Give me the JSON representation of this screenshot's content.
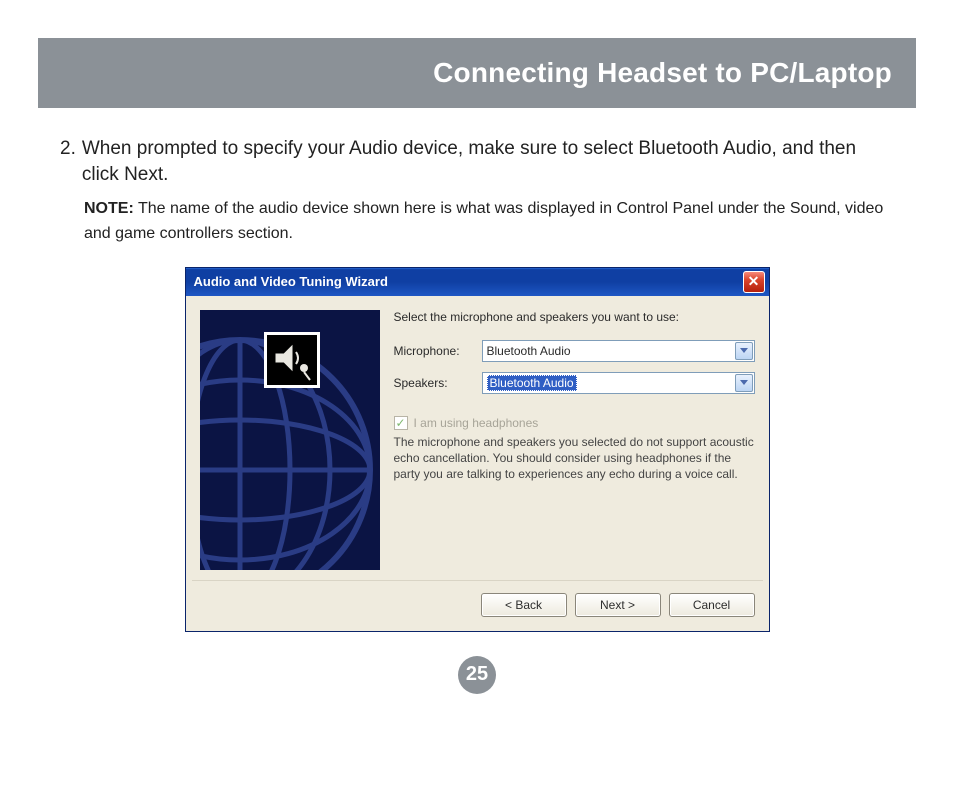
{
  "header": {
    "title": "Connecting Headset to PC/Laptop"
  },
  "step": {
    "number": "2.",
    "text": "When prompted to specify your Audio device, make sure to select Bluetooth Audio, and then click Next."
  },
  "note": {
    "label": "NOTE:",
    "text": "The name of the audio device shown here is what was displayed in Control Panel under the Sound, video and game controllers section."
  },
  "dialog": {
    "title": "Audio and Video Tuning Wizard",
    "instruction": "Select the microphone and speakers you want to use:",
    "fields": {
      "microphone": {
        "label": "Microphone:",
        "value": "Bluetooth Audio"
      },
      "speakers": {
        "label": "Speakers:",
        "value": "Bluetooth Audio"
      }
    },
    "checkbox": {
      "label": "I am using headphones",
      "checked": true,
      "disabled": true
    },
    "warning": "The microphone and speakers you selected do not support acoustic echo cancellation. You should consider using headphones if the party you are talking to experiences any echo during a voice call.",
    "buttons": {
      "back": "< Back",
      "next": "Next >",
      "cancel": "Cancel"
    }
  },
  "page_number": "25"
}
